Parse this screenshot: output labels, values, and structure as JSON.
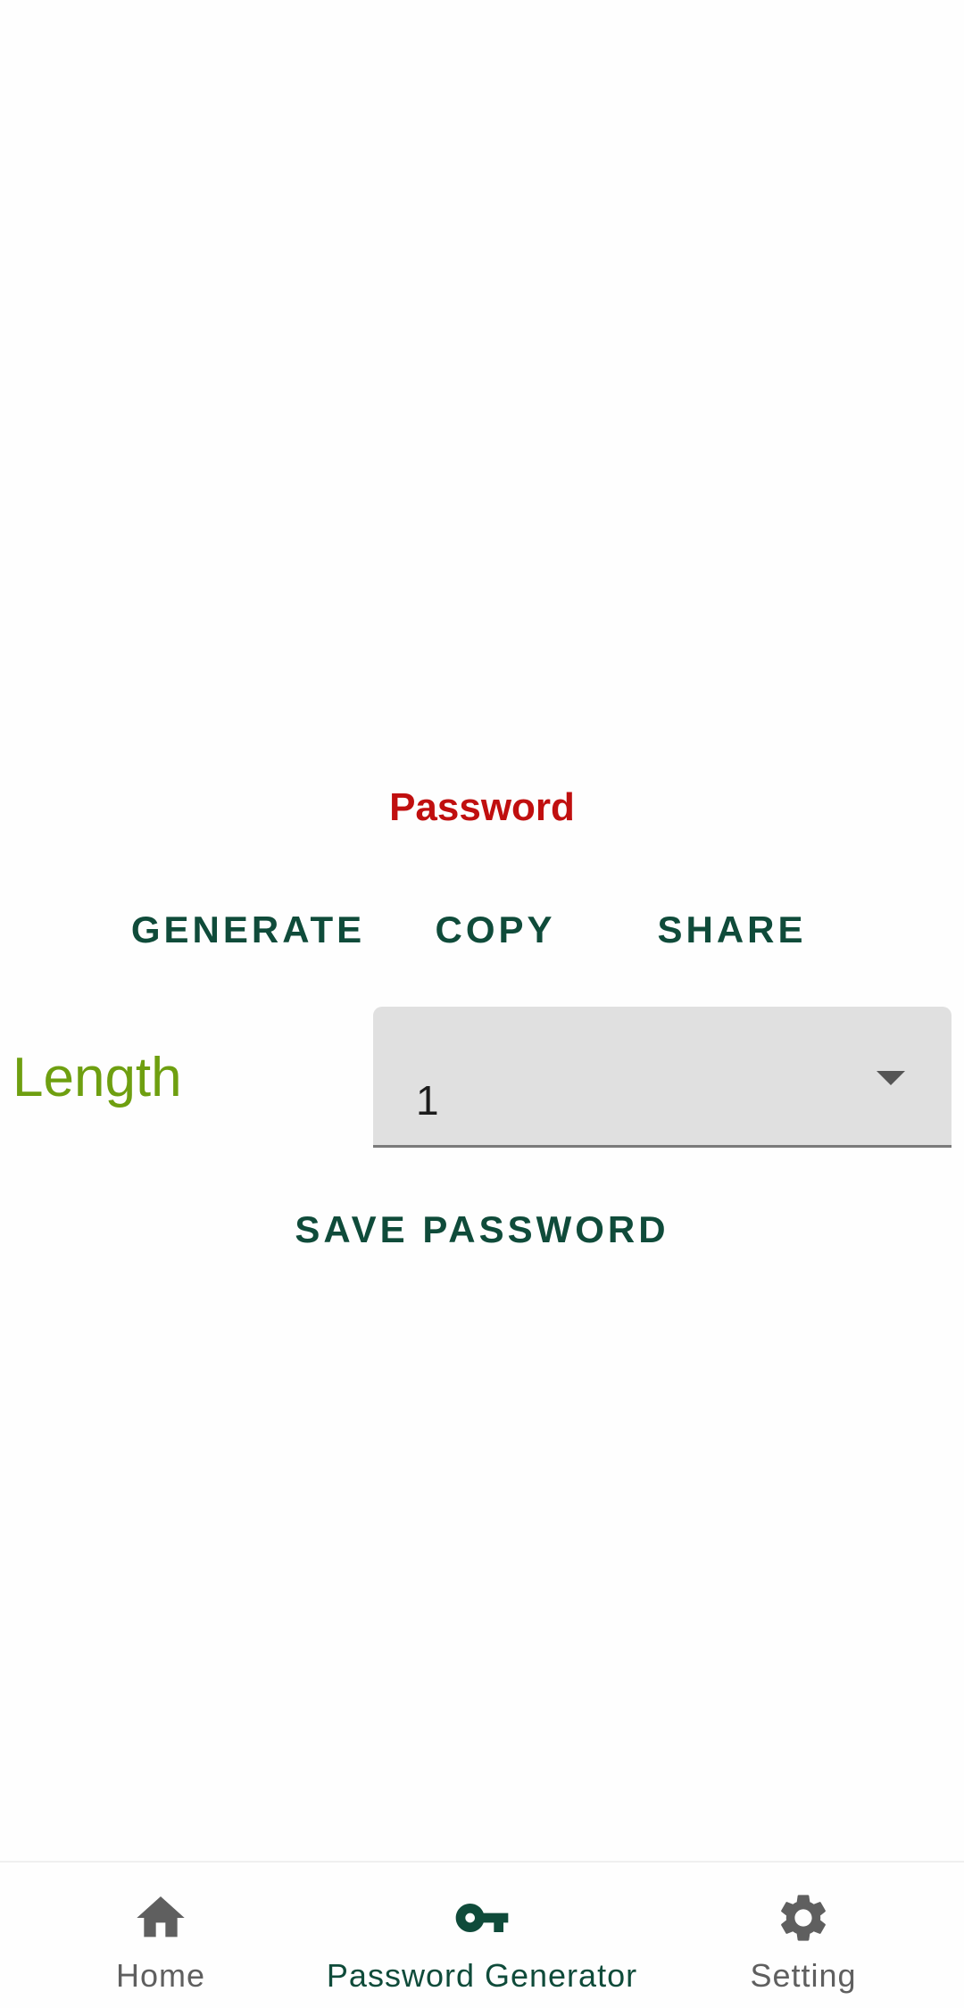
{
  "colors": {
    "password_label": "#c00f0f",
    "button_text": "#0f4b3a",
    "length_label": "#6e9f10",
    "nav_active": "#0f4b3a",
    "nav_inactive": "#5f5f5f"
  },
  "main": {
    "password_label": "Password",
    "buttons": {
      "generate": "GENERATE",
      "copy": "COPY",
      "share": "SHARE"
    },
    "length_label": "Length",
    "length_select": {
      "value": "1"
    },
    "save_button": "SAVE PASSWORD"
  },
  "bottom_nav": {
    "items": [
      {
        "label": "Home",
        "icon": "home-icon",
        "active": false
      },
      {
        "label": "Password Generator",
        "icon": "key-icon",
        "active": true
      },
      {
        "label": "Setting",
        "icon": "gear-icon",
        "active": false
      }
    ]
  }
}
